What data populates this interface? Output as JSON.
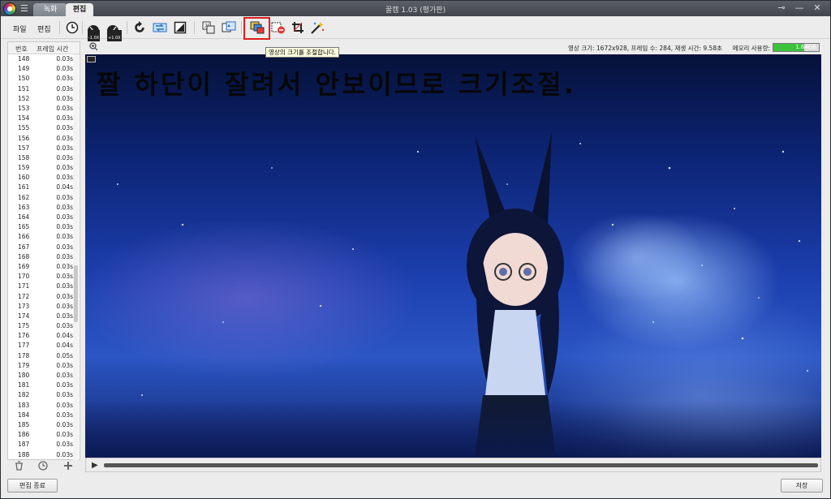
{
  "app": {
    "title": "꿀캠 1.03 (평가판)",
    "tabs": [
      {
        "label": "녹화"
      },
      {
        "label": "편집"
      }
    ],
    "window_controls": {
      "key": "⊸",
      "minimize": "—",
      "close": "✕"
    }
  },
  "toolbar": {
    "menu_file": "파일",
    "menu_edit": "편집",
    "speed_down_badge": "-1.0X",
    "speed_up_badge": "+1.0X",
    "tooltip": "영상의 크기를 조절합니다."
  },
  "frame_list": {
    "header_num": "번호",
    "header_time": "프레임 시간",
    "rows": [
      {
        "n": "148",
        "t": "0.03s"
      },
      {
        "n": "149",
        "t": "0.03s"
      },
      {
        "n": "150",
        "t": "0.03s"
      },
      {
        "n": "151",
        "t": "0.03s"
      },
      {
        "n": "152",
        "t": "0.03s"
      },
      {
        "n": "153",
        "t": "0.03s"
      },
      {
        "n": "154",
        "t": "0.03s"
      },
      {
        "n": "155",
        "t": "0.03s"
      },
      {
        "n": "156",
        "t": "0.03s"
      },
      {
        "n": "157",
        "t": "0.03s"
      },
      {
        "n": "158",
        "t": "0.03s"
      },
      {
        "n": "159",
        "t": "0.03s"
      },
      {
        "n": "160",
        "t": "0.03s"
      },
      {
        "n": "161",
        "t": "0.04s"
      },
      {
        "n": "162",
        "t": "0.03s"
      },
      {
        "n": "163",
        "t": "0.03s"
      },
      {
        "n": "164",
        "t": "0.03s"
      },
      {
        "n": "165",
        "t": "0.03s"
      },
      {
        "n": "166",
        "t": "0.03s"
      },
      {
        "n": "167",
        "t": "0.03s"
      },
      {
        "n": "168",
        "t": "0.03s"
      },
      {
        "n": "169",
        "t": "0.03s"
      },
      {
        "n": "170",
        "t": "0.03s"
      },
      {
        "n": "171",
        "t": "0.03s"
      },
      {
        "n": "172",
        "t": "0.03s"
      },
      {
        "n": "173",
        "t": "0.03s"
      },
      {
        "n": "174",
        "t": "0.03s"
      },
      {
        "n": "175",
        "t": "0.03s"
      },
      {
        "n": "176",
        "t": "0.04s"
      },
      {
        "n": "177",
        "t": "0.04s"
      },
      {
        "n": "178",
        "t": "0.05s"
      },
      {
        "n": "179",
        "t": "0.03s"
      },
      {
        "n": "180",
        "t": "0.03s"
      },
      {
        "n": "181",
        "t": "0.03s"
      },
      {
        "n": "182",
        "t": "0.03s"
      },
      {
        "n": "183",
        "t": "0.03s"
      },
      {
        "n": "184",
        "t": "0.03s"
      },
      {
        "n": "185",
        "t": "0.03s"
      },
      {
        "n": "186",
        "t": "0.03s"
      },
      {
        "n": "187",
        "t": "0.03s"
      },
      {
        "n": "188",
        "t": "0.03s"
      }
    ]
  },
  "status": {
    "video_info": "영상 크기: 1672x928, 프레임 수: 284, 재생 시간: 9.58초",
    "memory_label": "메모리 사용량:",
    "memory_value": "1.64GB",
    "memory_fraction": 0.68,
    "memory_color": "#3cc23c"
  },
  "video": {
    "caption": "짤 하단이 잘려서 안보이므로 크기조절."
  },
  "bottom": {
    "end_edit": "편집 종료",
    "save": "저장"
  },
  "colors": {
    "highlight": "#e01c1c",
    "titlebar": "#4b5057"
  }
}
